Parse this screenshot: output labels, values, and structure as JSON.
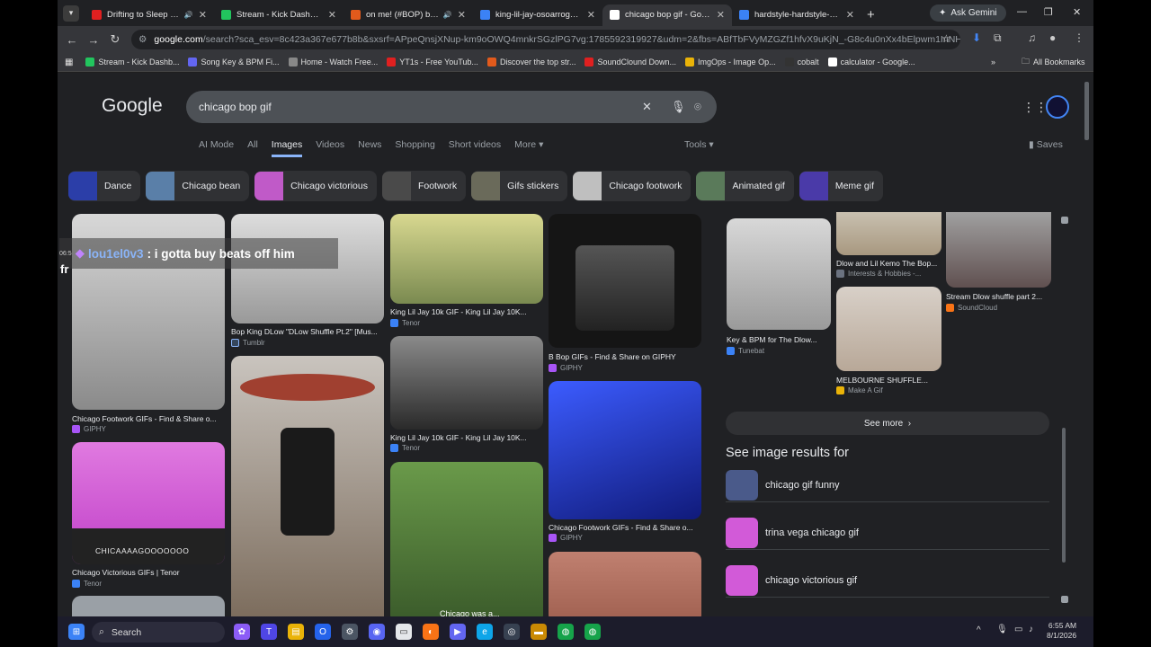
{
  "browser": {
    "tabs": [
      {
        "title": "Drifting to Sleep with F",
        "fav_color": "#e02020",
        "sound": true
      },
      {
        "title": "Stream - Kick Dashboard",
        "fav_color": "#22c55e",
        "sound": false
      },
      {
        "title": "on me! (#BOP) by EDD",
        "fav_color": "#e25a1c",
        "sound": true
      },
      {
        "title": "king-lil-jay-osoarrogant.gif",
        "fav_color": "#3b82f6",
        "sound": false
      },
      {
        "title": "chicago bop gif - Google S",
        "fav_color": "#ffffff",
        "sound": false,
        "active": true
      },
      {
        "title": "hardstyle-hardstyle-shuffle",
        "fav_color": "#3b82f6",
        "sound": false
      }
    ],
    "ask_gemini": "Ask Gemini",
    "url_prefix": "google.com",
    "url_rest": "/search?sca_esv=8c423a367e677b8b&sxsrf=APpeQnsjXNup-km9oOWQ4mnkrSGzlPG7vg:1785592319927&udm=2&fbs=ABfTbFVyMZGZf1hfvX9uKjN_-G8c4u0nXx4bElpwm1InNH832VTJOOCx...",
    "bookmarks": [
      {
        "label": "Stream - Kick Dashb...",
        "color": "#22c55e"
      },
      {
        "label": "Song Key & BPM Fi...",
        "color": "#6366f1"
      },
      {
        "label": "Home - Watch Free...",
        "color": "#888888"
      },
      {
        "label": "YT1s - Free YouTub...",
        "color": "#e02020"
      },
      {
        "label": "Discover the top str...",
        "color": "#e25a1c"
      },
      {
        "label": "SoundClound Down...",
        "color": "#e02020"
      },
      {
        "label": "ImgOps - Image Op...",
        "color": "#eab308"
      },
      {
        "label": "cobalt",
        "color": "#333333"
      },
      {
        "label": "calculator - Google...",
        "color": "#ffffff"
      }
    ],
    "all_bookmarks": "All Bookmarks"
  },
  "google": {
    "logo": "Google",
    "query": "chicago bop gif",
    "tabs": [
      "AI Mode",
      "All",
      "Images",
      "Videos",
      "News",
      "Shopping",
      "Short videos",
      "More"
    ],
    "active_tab": "Images",
    "tools": "Tools",
    "saves": "Saves",
    "chips": [
      {
        "label": "Dance",
        "color": "#2b3ea8"
      },
      {
        "label": "Chicago bean",
        "color": "#5a7fa8"
      },
      {
        "label": "Chicago victorious",
        "color": "#c05ac8"
      },
      {
        "label": "Footwork",
        "color": "#4a4a4a"
      },
      {
        "label": "Gifs stickers",
        "color": "#6a6a5a"
      },
      {
        "label": "Chicago footwork",
        "color": "#bfbfbf"
      },
      {
        "label": "Animated gif",
        "color": "#5a7a5a"
      },
      {
        "label": "Meme gif",
        "color": "#4a3aa8"
      }
    ]
  },
  "results": {
    "col1": [
      {
        "caption": "Chicago Footwork GIFs - Find & Share o...",
        "source": "GIPHY",
        "src_color": "#a855f7",
        "img_color": "#9a9a9a"
      },
      {
        "caption": "Chicago Victorious GIFs | Tenor",
        "source": "Tenor",
        "src_color": "#3b82f6",
        "img_color": "#d25ad8",
        "img_text": "CHICAAAAGOOOOOOO"
      }
    ],
    "col2": [
      {
        "caption": "Bop King DLow \"DLow Shuffle Pt.2\" [Mus...",
        "source": "Tumblr",
        "src_color": "#35465c",
        "img_color": "#b8b8b8"
      }
    ],
    "col3": [
      {
        "caption": "King Lil Jay 10k GIF - King Lil Jay 10K...",
        "source": "Tenor",
        "src_color": "#3b82f6",
        "img_color": "#c8c870"
      },
      {
        "caption": "King Lil Jay 10k GIF - King Lil Jay 10K...",
        "source": "Tenor",
        "src_color": "#3b82f6",
        "img_color": "#6a6a6a"
      },
      {
        "caption": "",
        "source": "",
        "img_text": "Chicago was a..."
      }
    ],
    "col4": [
      {
        "caption": "B Bop GIFs - Find & Share on GIPHY",
        "source": "GIPHY",
        "src_color": "#a855f7",
        "img_color": "#1a1a1a"
      },
      {
        "caption": "Chicago Footwork GIFs - Find & Share o...",
        "source": "GIPHY",
        "src_color": "#a855f7",
        "img_color": "#1c2fb8"
      }
    ],
    "side": [
      {
        "caption": "Key & BPM for The Dlow...",
        "source": "Tunebat",
        "src_color": "#3b82f6"
      },
      {
        "caption": "Dlow and Lil Kemo The Bop...",
        "source": "Interests & Hobbies -...",
        "src_color": "#6b7280"
      },
      {
        "caption": "MELBOURNE SHUFFLE...",
        "source": "Make A Gif",
        "src_color": "#eab308"
      },
      {
        "caption": "Stream Dlow shuffle part 2...",
        "source": "SoundCloud",
        "src_color": "#f97316"
      }
    ],
    "see_more": "See more",
    "see_image_results": "See image results for",
    "related": [
      {
        "label": "chicago gif funny",
        "color": "#4a5a8a"
      },
      {
        "label": "trina vega chicago gif",
        "color": "#d25ad8"
      },
      {
        "label": "chicago victorious gif",
        "color": "#d25ad8"
      }
    ]
  },
  "stream_overlay": {
    "timestamp": "06:5",
    "username": "lou1el0v3",
    "message": ": i gotta buy beats off him",
    "trailing": "fr"
  },
  "taskbar": {
    "search": "Search",
    "time": "6:55 AM",
    "date": "8/1/2026"
  }
}
